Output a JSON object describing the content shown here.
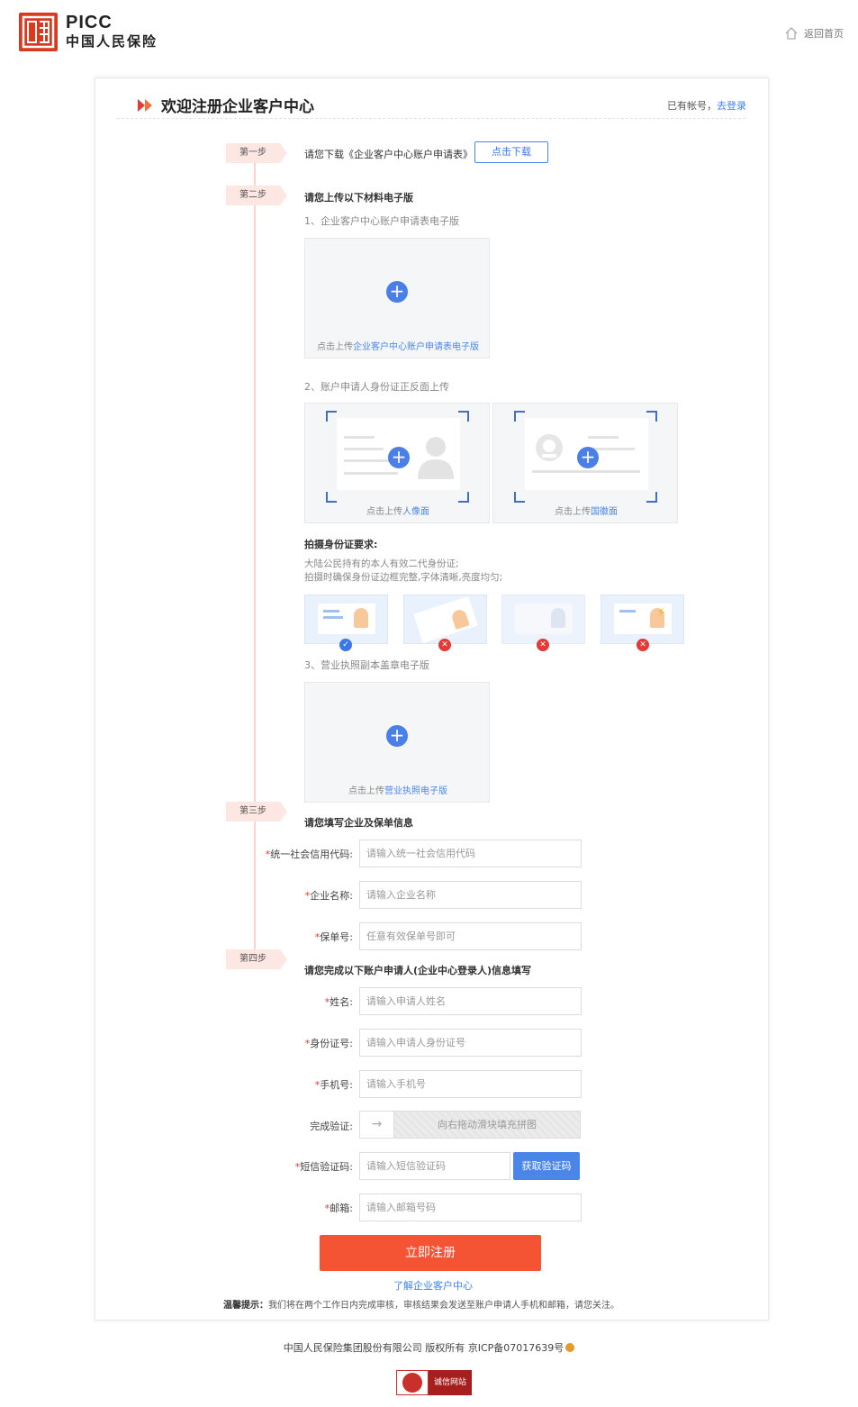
{
  "header": {
    "logo_text": "PICC",
    "logo_cn": "中国人民保险",
    "home_link": "返回首页"
  },
  "card": {
    "title": "欢迎注册企业客户中心",
    "has_account": "已有帐号，",
    "login_link": "去登录"
  },
  "steps": {
    "step1": {
      "tag": "第一步",
      "text": "请您下载《企业客户中心账户申请表》",
      "button": "点击下载"
    },
    "step2": {
      "tag": "第二步",
      "text": "请您上传以下材料电子版",
      "item1_label": "1、企业客户中心账户申请表电子版",
      "item1_caption_prefix": "点击上传",
      "item1_caption_link": "企业客户中心账户申请表电子版",
      "item2_label": "2、账户申请人身份证正反面上传",
      "portrait_prefix": "点击上传",
      "portrait_link": "人像面",
      "emblem_prefix": "点击上传",
      "emblem_link": "国徽面",
      "req_title": "拍摄身份证要求:",
      "req_line1": "大陆公民持有的本人有效二代身份证;",
      "req_line2": "拍摄时确保身份证边框完整,字体清晰,亮度均匀;",
      "item3_label": "3、营业执照副本盖章电子版",
      "item3_prefix": "点击上传",
      "item3_link": "营业执照电子版"
    },
    "step3": {
      "tag": "第三步",
      "text": "请您填写企业及保单信息"
    },
    "step4": {
      "tag": "第四步",
      "text": "请您完成以下账户申请人(企业中心登录人)信息填写"
    }
  },
  "form": {
    "credit_code": {
      "label": "统一社会信用代码:",
      "placeholder": "请输入统一社会信用代码"
    },
    "company_name": {
      "label": "企业名称:",
      "placeholder": "请输入企业名称"
    },
    "policy_no": {
      "label": "保单号:",
      "placeholder": "任意有效保单号即可"
    },
    "name": {
      "label": "姓名:",
      "placeholder": "请输入申请人姓名"
    },
    "id_no": {
      "label": "身份证号:",
      "placeholder": "请输入申请人身份证号"
    },
    "phone": {
      "label": "手机号:",
      "placeholder": "请输入手机号"
    },
    "verify": {
      "label": "完成验证:",
      "slider_text": "向右拖动滑块填充拼图"
    },
    "sms": {
      "label": "短信验证码:",
      "placeholder": "请输入短信验证码",
      "button": "获取验证码"
    },
    "email": {
      "label": "邮箱:",
      "placeholder": "请输入邮箱号码"
    },
    "required_mark": "*"
  },
  "submit": "立即注册",
  "learn_link": "了解企业客户中心",
  "tip": {
    "label": "温馨提示：",
    "text": "我们将在两个工作日内完成审核，审核结果会发送至账户申请人手机和邮箱，请您关注。"
  },
  "footer": {
    "copyright": "中国人民保险集团股份有限公司 版权所有 京ICP备07017639号",
    "trust_badge": "诚信网站"
  },
  "colors": {
    "brand_red": "#d93a1f",
    "accent_blue": "#4a86e8",
    "submit_orange": "#f45434",
    "step_tag_bg": "#fde7e3"
  }
}
